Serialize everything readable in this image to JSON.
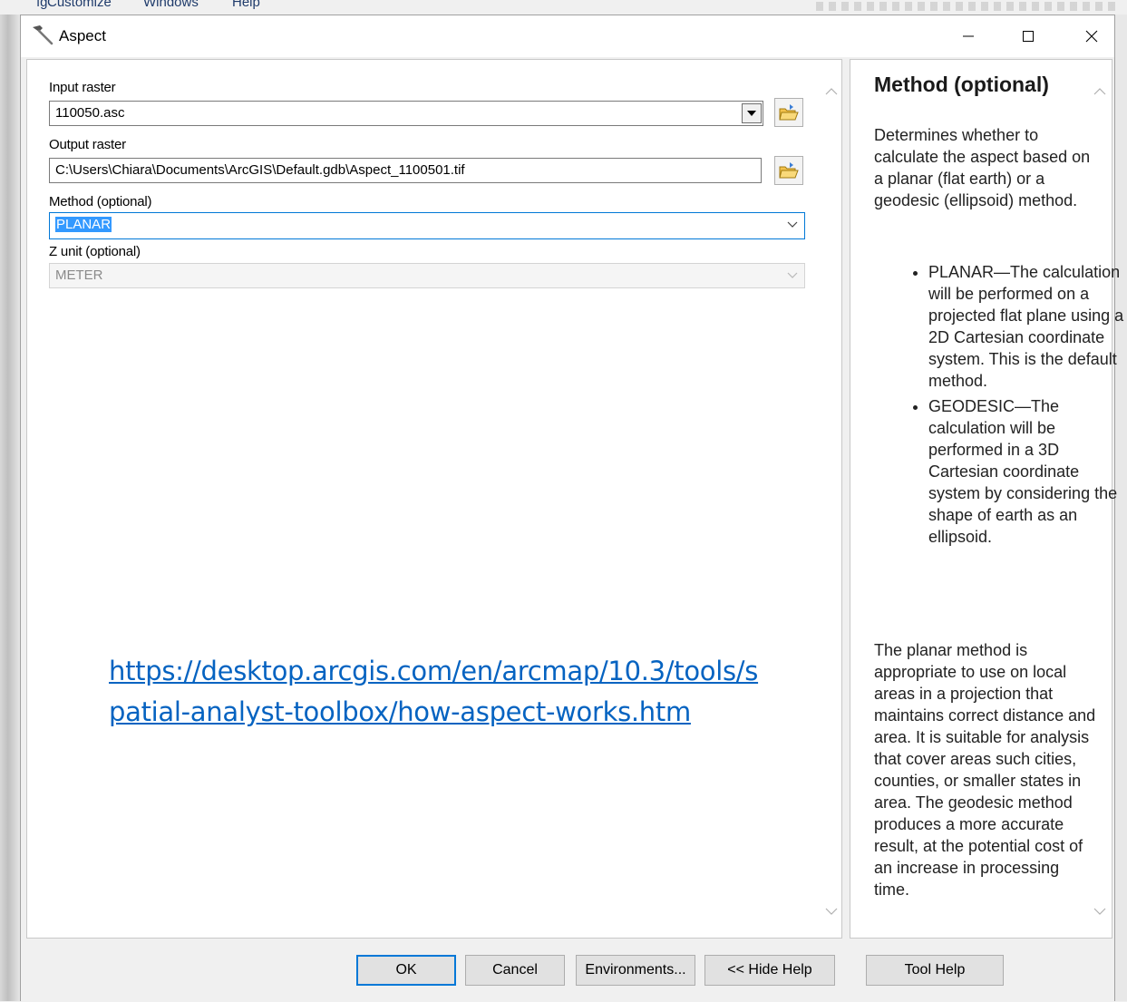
{
  "background_app": {
    "menu_items": [
      "ıg",
      "Customize",
      "Windows",
      "Help"
    ]
  },
  "window": {
    "title": "Aspect",
    "icon": "hammer-icon",
    "controls": [
      "minimize-icon",
      "maximize-icon",
      "close-icon"
    ]
  },
  "form": {
    "input_raster": {
      "label": "Input raster",
      "value": "110050.asc"
    },
    "output_raster": {
      "label": "Output raster",
      "value": "C:\\Users\\Chiara\\Documents\\ArcGIS\\Default.gdb\\Aspect_1100501.tif"
    },
    "method": {
      "label": "Method (optional)",
      "value": "PLANAR"
    },
    "z_unit": {
      "label": "Z unit (optional)",
      "value": "METER"
    }
  },
  "link": {
    "text": "https://desktop.arcgis.com/en/arcmap/10.3/tools/spatial-analyst-toolbox/how-aspect-works.htm"
  },
  "help": {
    "title": "Method (optional)",
    "intro": "Determines whether to calculate the aspect based on a planar (flat earth) or a geodesic (ellipsoid) method.",
    "items": [
      "PLANAR—The calculation will be performed on a projected flat plane using a 2D Cartesian coordinate system. This is the default method.",
      "GEODESIC—The calculation will be performed in a 3D Cartesian coordinate system by considering the shape of earth as an ellipsoid."
    ],
    "outro": "The planar method is appropriate to use on local areas in a projection that maintains correct distance and area. It is suitable for analysis that cover areas such cities, counties, or smaller states in area. The geodesic method produces a more accurate result, at the potential cost of an increase in processing time."
  },
  "buttons": {
    "ok": "OK",
    "cancel": "Cancel",
    "environments": "Environments...",
    "hide_help": "<< Hide Help",
    "tool_help": "Tool Help"
  },
  "colors": {
    "accent": "#0078d7",
    "link": "#0563c1",
    "selection": "#3399ff"
  }
}
